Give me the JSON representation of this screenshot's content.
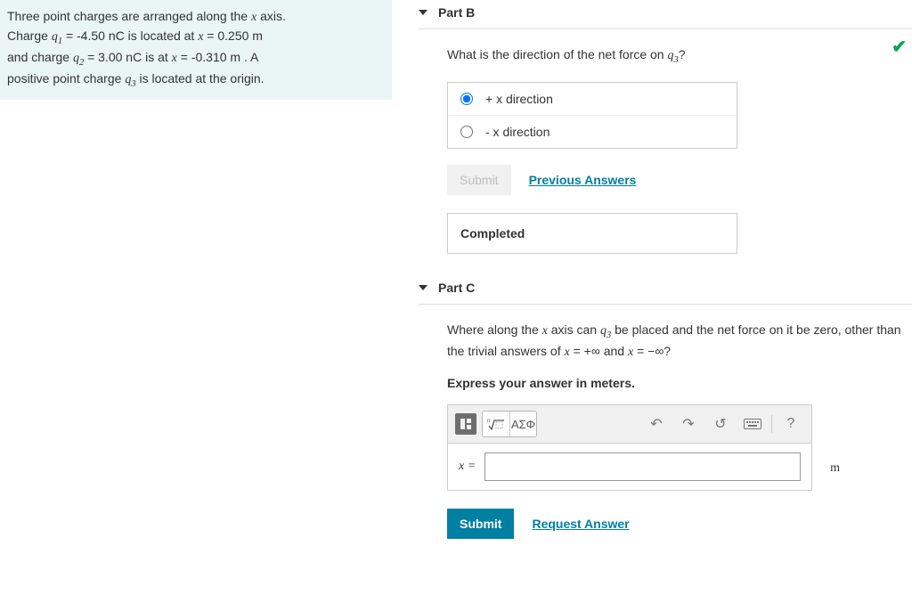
{
  "problem": {
    "line1_a": "Three point charges are arranged along the ",
    "line1_b": " axis.",
    "line2_a": "Charge ",
    "line2_b": " = -4.50 nC is located at ",
    "line2_c": " = 0.250 m",
    "line3_a": "and charge ",
    "line3_b": " = 3.00 nC is at ",
    "line3_c": " = -0.310 m . A",
    "line4_a": "positive point charge ",
    "line4_b": " is located at the origin.",
    "vars": {
      "x": "x",
      "q1": "q",
      "q1_sub": "1",
      "q2": "q",
      "q2_sub": "2",
      "q3": "q",
      "q3_sub": "3"
    }
  },
  "partB": {
    "title": "Part B",
    "question_a": "What is the direction of the net force on ",
    "question_b": "?",
    "choices": {
      "a": "+ x direction",
      "b": "- x direction"
    },
    "submit": "Submit",
    "prev": "Previous Answers",
    "completed": "Completed",
    "check": "✔"
  },
  "partC": {
    "title": "Part C",
    "q_a": "Where along the ",
    "q_b": " axis can ",
    "q_c": " be placed and the net force on it be zero, other than the trivial answers of ",
    "q_d": " = +∞ and ",
    "q_e": " = −∞?",
    "instruction": "Express your answer in meters.",
    "var_label": "x =",
    "unit": "m",
    "toolbar": {
      "templates_hint": "templates",
      "symbols": "ΑΣΦ",
      "help": "?"
    },
    "submit": "Submit",
    "request": "Request Answer"
  }
}
